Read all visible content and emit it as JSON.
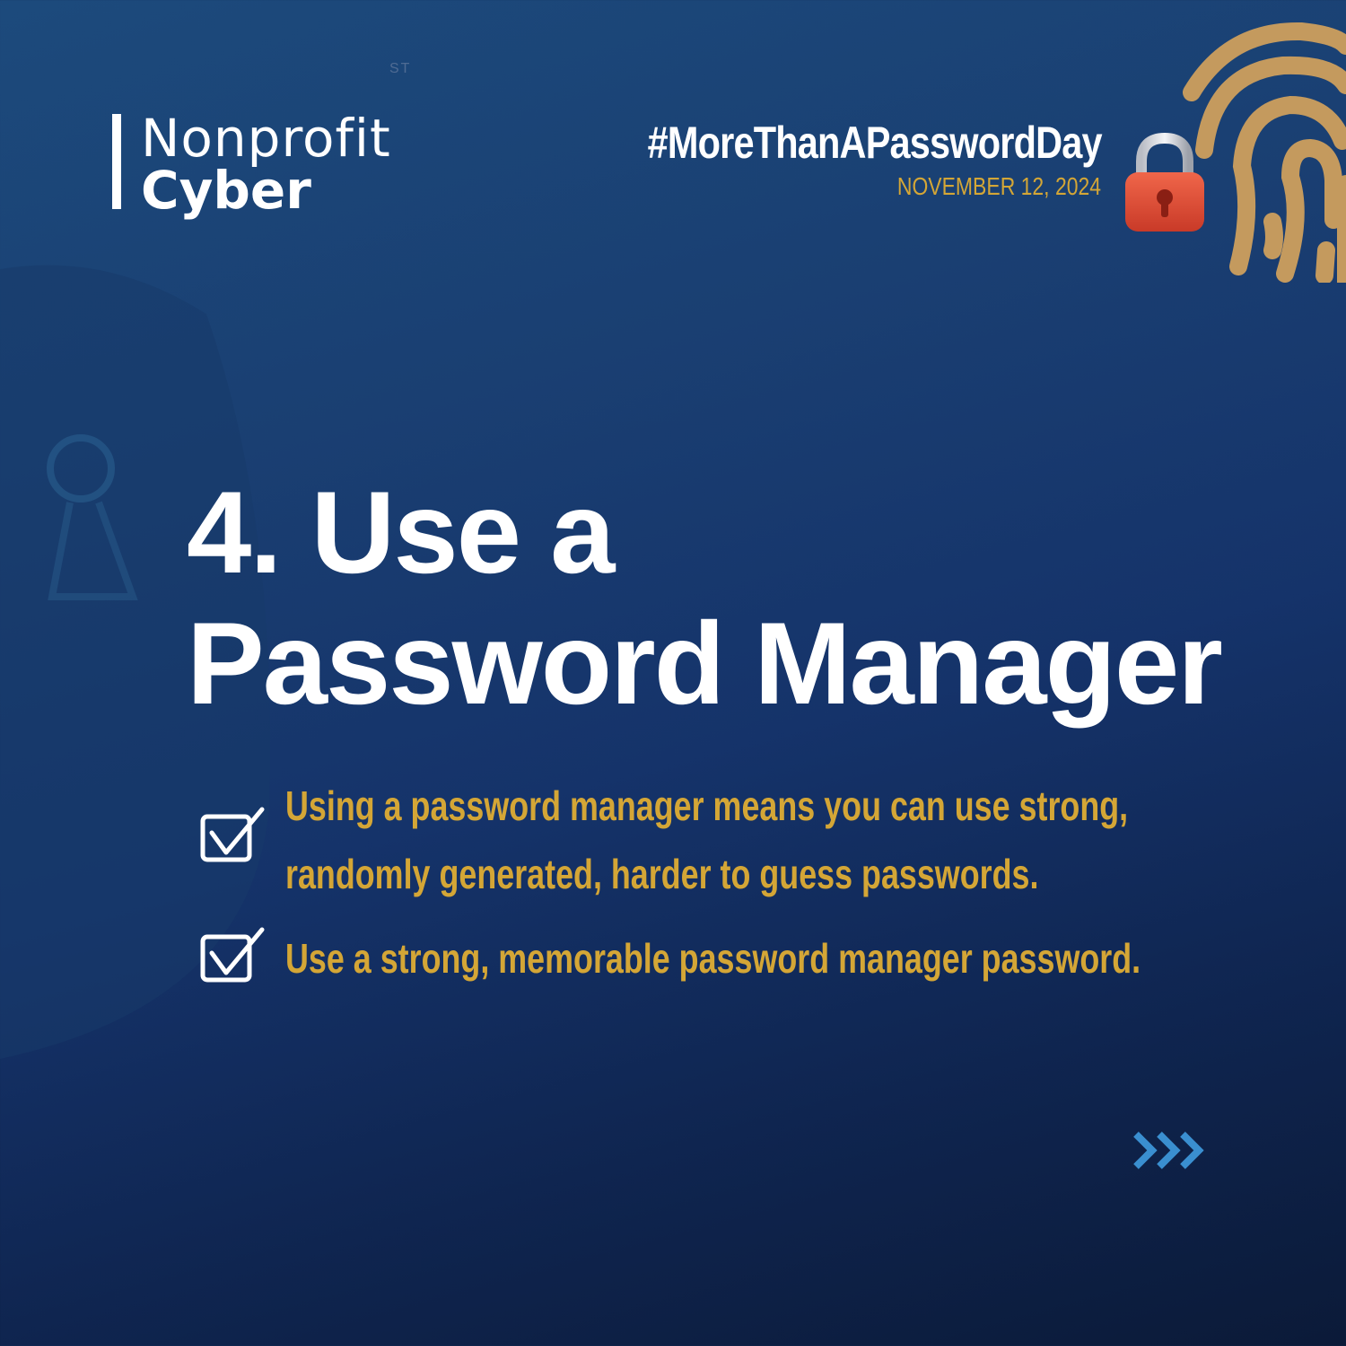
{
  "brand": {
    "line1": "Nonprofit",
    "line2": "Cyber"
  },
  "faint_mark": "ST",
  "campaign": {
    "hashtag": "#MoreThanAPasswordDay",
    "date": "NOVEMBER 12, 2024"
  },
  "headline": {
    "line1": "4. Use a",
    "line2": "Password Manager"
  },
  "bullets": [
    {
      "icon": "checkbox-check-icon",
      "text": "Using a password manager means you can use strong, randomly generated, harder to guess passwords."
    },
    {
      "icon": "checkbox-check-icon",
      "text": "Use a strong, memorable password manager password."
    }
  ],
  "icons": [
    "fingerprint-icon",
    "padlock-icon",
    "next-arrows-icon",
    "keyhole-icon"
  ],
  "colors": {
    "accent_gold": "#d4a636",
    "fingerprint_tan": "#c49a5e",
    "padlock_red": "#e24a33",
    "arrow_blue": "#3a8fd0",
    "background_top": "#1c4a7c",
    "background_bottom": "#0b1a38"
  }
}
